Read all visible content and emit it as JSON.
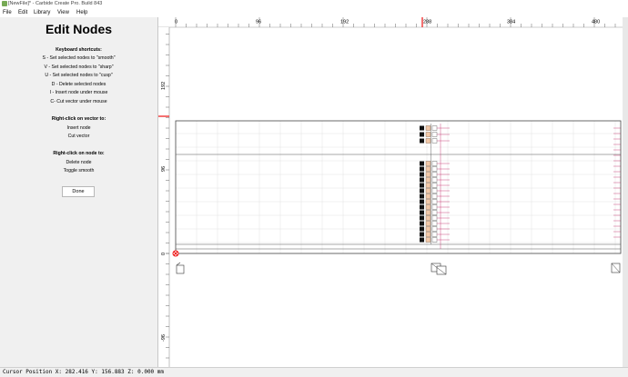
{
  "window": {
    "title": "[NewFile]* - Carbide Create Pro. Build 843"
  },
  "menu": [
    "File",
    "Edit",
    "Library",
    "View",
    "Help"
  ],
  "panel": {
    "title": "Edit Nodes",
    "keyboard_header": "Keyboard shortcuts:",
    "shortcuts": [
      "S - Set selected nodes to \"smooth\"",
      "V - Set selected nodes to \"sharp\"",
      "U - Set selected nodes to \"cusp\"",
      "D - Delete selected nodes",
      "I - Insert node under mouse",
      "C- Cut vector under mouse"
    ],
    "vector_header": "Right-click on vector to:",
    "vector_actions": [
      "Insert node",
      "Cut vector"
    ],
    "node_header": "Right-click on node to:",
    "node_actions": [
      "Delete node",
      "Toggle smooth"
    ],
    "done_label": "Done"
  },
  "ruler": {
    "top_ticks": [
      "0",
      "96",
      "192",
      "288",
      "384",
      "480"
    ],
    "left_ticks": [
      "192",
      "96",
      "0",
      "-96"
    ]
  },
  "status": {
    "cursor": "Cursor Position X: 282.416 Y: 156.883 Z: 0.000 mm"
  },
  "colors": {
    "ruler_marker": "#ee1111",
    "node_dark": "#111111",
    "node_light": "#f2c9a9",
    "vector_line": "#444444",
    "tab_marker": "#c02060"
  }
}
